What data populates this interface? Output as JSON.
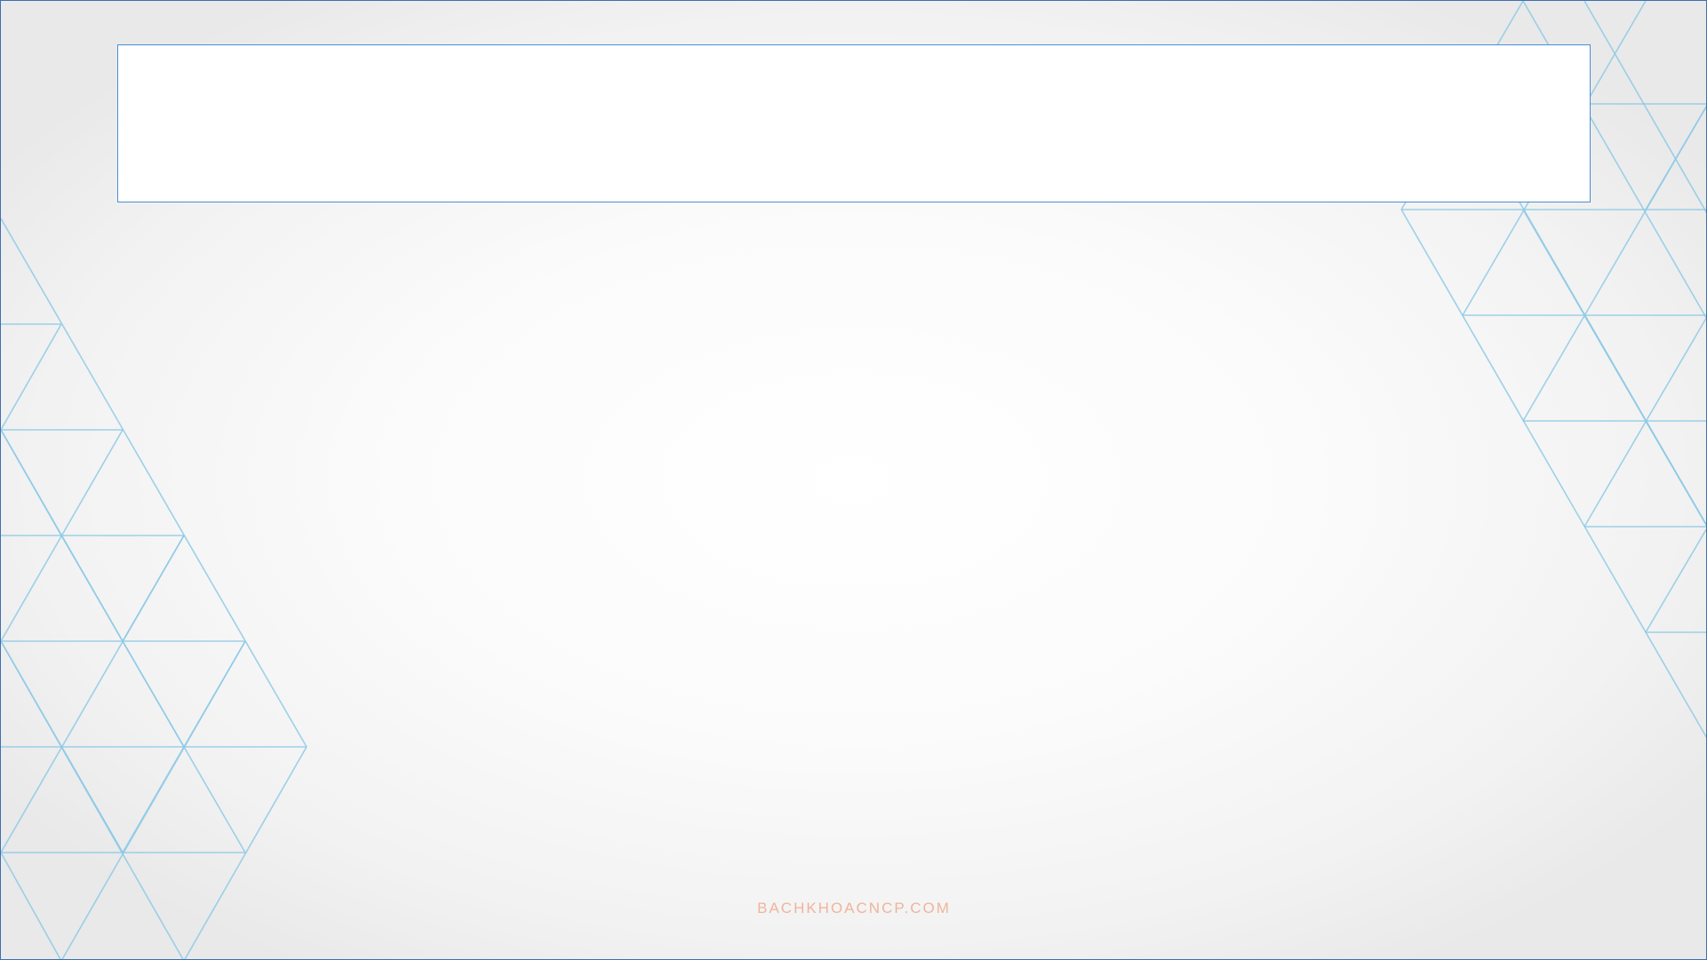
{
  "slide": {
    "title_text": "",
    "footer_watermark": "BACHKHOACNCP.COM"
  },
  "colors": {
    "triangle_lines": "#8ecae6",
    "title_box_border": "#4a8fd4",
    "footer_text": "#f0b49c",
    "slide_border": "#3f6fb0"
  },
  "decorations": {
    "left_pattern_icon": "triangle-grid",
    "right_pattern_icon": "triangle-grid"
  }
}
